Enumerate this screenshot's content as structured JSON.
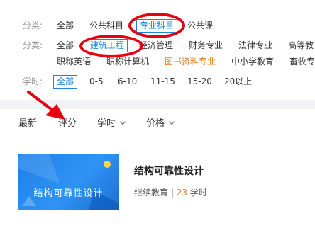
{
  "filters": {
    "category_label": "分类:",
    "category_items": [
      "全部",
      "公共科目",
      "专业科目",
      "公共课"
    ],
    "subject_label": "分类:",
    "subject_row1": [
      "全部",
      "建筑工程",
      "经济管理",
      "财务专业",
      "法律专业",
      "高等教"
    ],
    "subject_row2": [
      "职称英语",
      "职称计算机",
      "图书资料专业",
      "中小学教育",
      "畜牧专"
    ],
    "hours_label": "学时:",
    "hours_items": [
      "全部",
      "0-5",
      "6-10",
      "11-15",
      "15-20",
      "20以上"
    ]
  },
  "sort": {
    "newest": "最新",
    "rating": "评分",
    "hours": "学时",
    "price": "价格"
  },
  "course": {
    "thumb_text": "结构可靠性设计",
    "title": "结构可靠性设计",
    "provider": "继续教育 | ",
    "hours_value": "23",
    "hours_unit": " 学时"
  },
  "colors": {
    "accent": "#1d86d9",
    "highlight_ring": "#e60012",
    "orange": "#e67e22"
  }
}
